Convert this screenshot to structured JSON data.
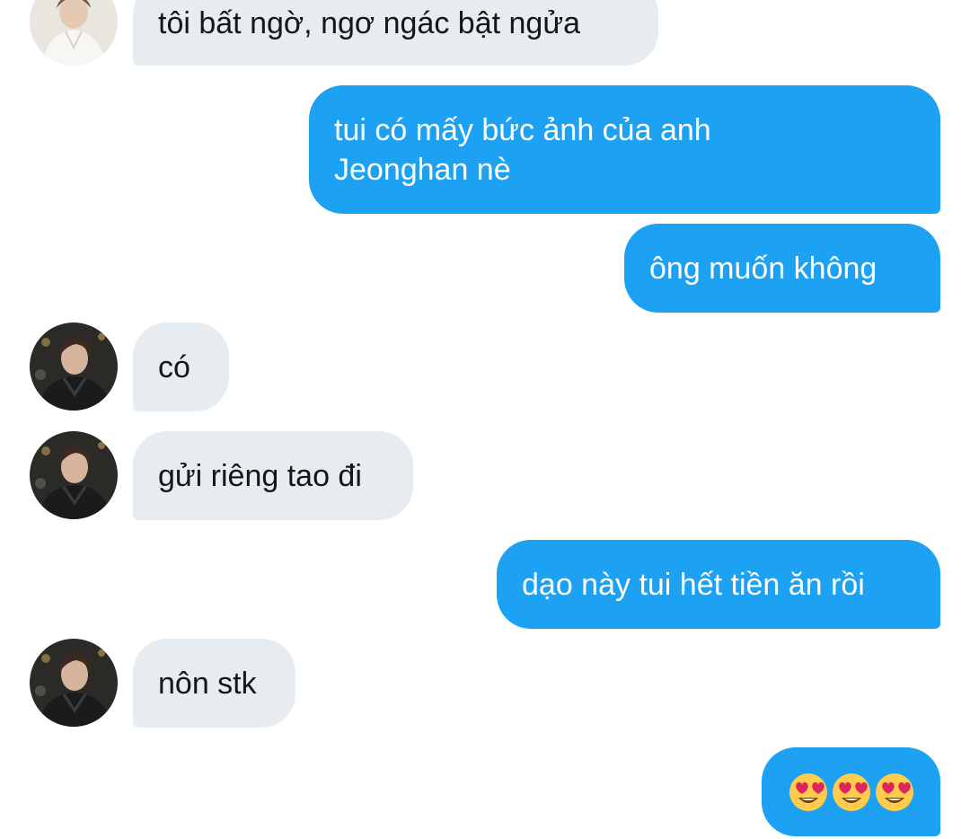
{
  "messages": [
    {
      "side": "in",
      "avatar": "user-a-avatar",
      "text": "tôi bất ngờ, ngơ ngác bật ngửa"
    },
    {
      "side": "out",
      "text": "tui có mấy bức ảnh của anh Jeonghan nè"
    },
    {
      "side": "out",
      "text": "ông muốn không"
    },
    {
      "side": "in",
      "avatar": "user-b-avatar",
      "text": "có"
    },
    {
      "side": "in",
      "avatar": "user-b-avatar",
      "text": "gửi riêng tao đi"
    },
    {
      "side": "out",
      "text": "dạo này tui hết tiền ăn rồi"
    },
    {
      "side": "in",
      "avatar": "user-b-avatar",
      "text": "nôn stk"
    },
    {
      "side": "out",
      "emoji": [
        "heart-eyes-emoji",
        "heart-eyes-emoji",
        "heart-eyes-emoji"
      ]
    }
  ],
  "colors": {
    "incoming_bubble": "#e6ecf0",
    "outgoing_bubble": "#1da1f2",
    "incoming_text": "#14171a",
    "outgoing_text": "#ffffff"
  }
}
